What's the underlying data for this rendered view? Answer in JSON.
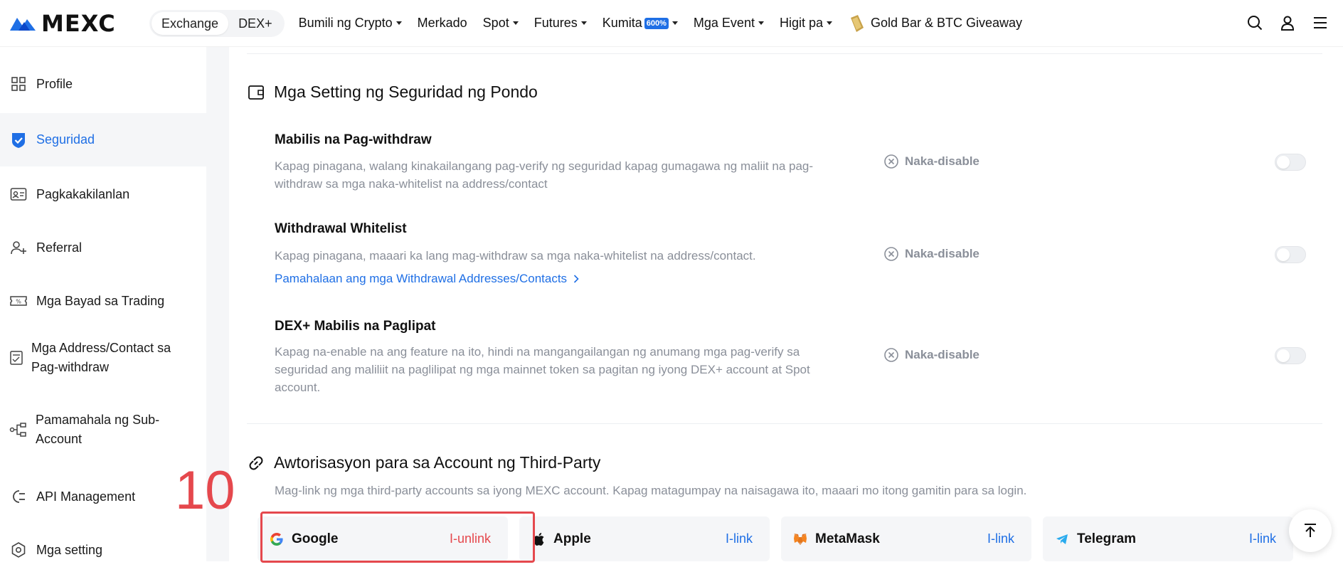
{
  "header": {
    "logo_text": "MEXC",
    "switcher": [
      "Exchange",
      "DEX+"
    ],
    "nav": [
      {
        "label": "Bumili ng Crypto",
        "caret": true
      },
      {
        "label": "Merkado",
        "caret": false
      },
      {
        "label": "Spot",
        "caret": true
      },
      {
        "label": "Futures",
        "caret": true
      },
      {
        "label": "Kumita",
        "caret": true,
        "badge": "600%"
      },
      {
        "label": "Mga Event",
        "caret": true
      },
      {
        "label": "Higit pa",
        "caret": true
      }
    ],
    "giveaway": "Gold Bar & BTC Giveaway",
    "icons": [
      "search-icon",
      "user-icon",
      "menu-icon"
    ]
  },
  "sidebar": {
    "items": [
      {
        "label": "Profile",
        "icon": "dashboard-icon"
      },
      {
        "label": "Seguridad",
        "icon": "shield-icon",
        "active": true
      },
      {
        "label": "Pagkakakilanlan",
        "icon": "id-card-icon"
      },
      {
        "label": "Referral",
        "icon": "user-plus-icon"
      },
      {
        "label": "Mga Bayad sa Trading",
        "icon": "ticket-icon"
      },
      {
        "label": "Mga Address/Contact sa Pag-withdraw",
        "icon": "address-book-icon"
      },
      {
        "label": "Pamamahala ng Sub-Account",
        "icon": "hierarchy-icon"
      },
      {
        "label": "API Management",
        "icon": "plug-icon"
      },
      {
        "label": "Mga setting",
        "icon": "settings-icon"
      }
    ]
  },
  "fund_security": {
    "title": "Mga Setting ng Seguridad ng Pondo",
    "rows": [
      {
        "title": "Mabilis na Pag-withdraw",
        "desc": "Kapag pinagana, walang kinakailangang pag-verify ng seguridad kapag gumagawa ng maliit na pag-withdraw sa mga naka-whitelist na address/contact",
        "status": "Naka-disable"
      },
      {
        "title": "Withdrawal Whitelist",
        "desc": "Kapag pinagana, maaari ka lang mag-withdraw sa mga naka-whitelist na address/contact.",
        "link": "Pamahalaan ang mga Withdrawal Addresses/Contacts",
        "status": "Naka-disable"
      },
      {
        "title": "DEX+ Mabilis na Paglipat",
        "desc": "Kapag na-enable na ang feature na ito, hindi na mangangailangan ng anumang mga pag-verify sa seguridad ang maliliit na paglilipat ng mga mainnet token sa pagitan ng iyong DEX+ account at Spot account.",
        "status": "Naka-disable"
      }
    ]
  },
  "third_party": {
    "title": "Awtorisasyon para sa Account ng Third-Party",
    "desc": "Mag-link ng mga third-party accounts sa iyong MEXC account. Kapag matagumpay na naisagawa ito, maaari mo itong gamitin para sa login.",
    "cards": [
      {
        "name": "Google",
        "action": "I-unlink",
        "icon": "google-icon"
      },
      {
        "name": "Apple",
        "action": "I-link",
        "icon": "apple-icon"
      },
      {
        "name": "MetaMask",
        "action": "I-link",
        "icon": "metamask-icon"
      },
      {
        "name": "Telegram",
        "action": "I-link",
        "icon": "telegram-icon"
      }
    ]
  },
  "annotation": "10",
  "colors": {
    "accent": "#1f6fe5",
    "danger": "#e5484d",
    "muted": "#8a8f99"
  }
}
